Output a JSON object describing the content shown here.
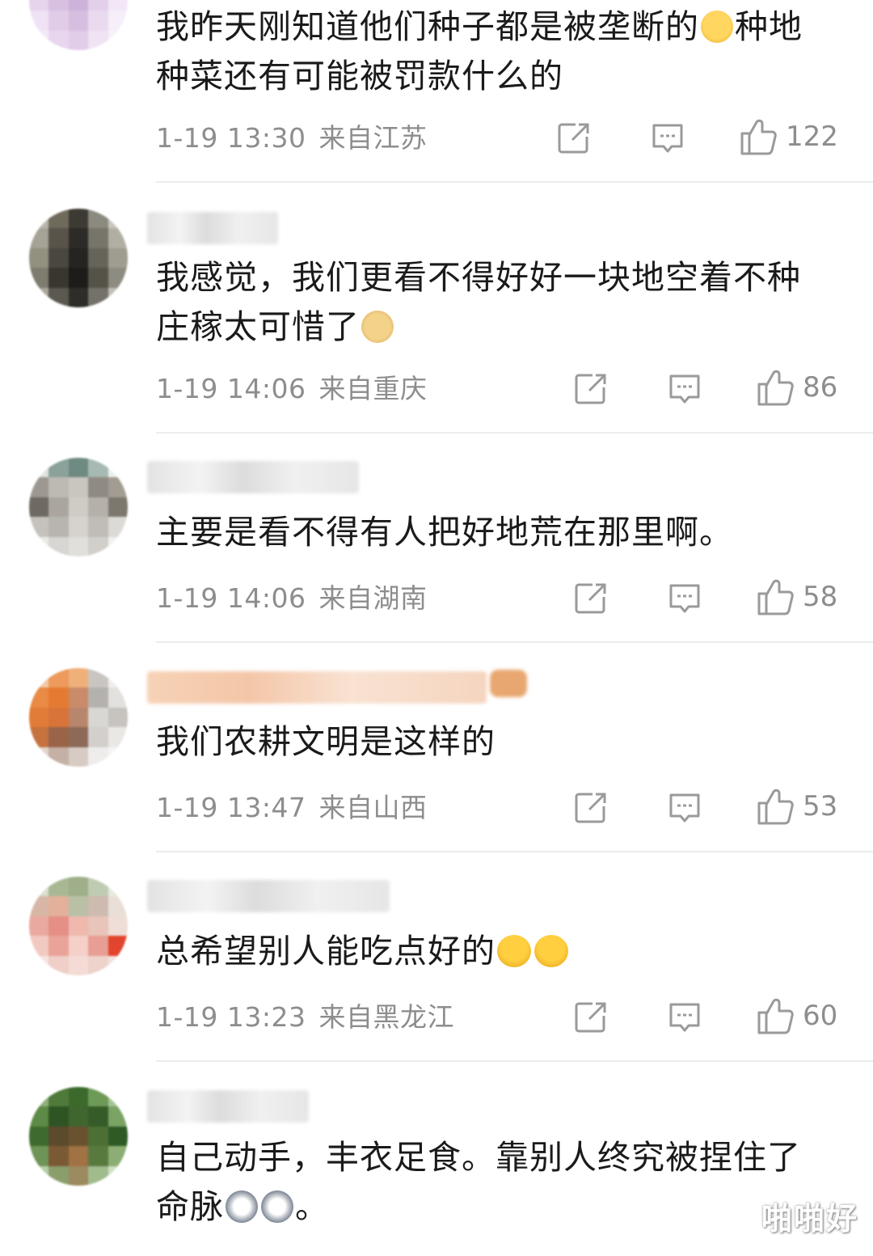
{
  "comments": [
    {
      "text": "我昨天刚知道他们种子都是被垄断的",
      "text_after_emoji": "种地种菜还有可能被罚款什么的",
      "emoji": "laugh-cry-emoji",
      "time": "1-19 13:30",
      "location": "来自江苏",
      "likes": "122"
    },
    {
      "text": "我感觉，我们更看不得好好一块地空着不种庄稼太可惜了",
      "emoji": "doge-emoji",
      "time": "1-19 14:06",
      "location": "来自重庆",
      "likes": "86"
    },
    {
      "text": "主要是看不得有人把好地荒在那里啊。",
      "time": "1-19 14:06",
      "location": "来自湖南",
      "likes": "58"
    },
    {
      "text": "我们农耕文明是这样的",
      "time": "1-19 13:47",
      "location": "来自山西",
      "likes": "53"
    },
    {
      "text": "总希望别人能吃点好的",
      "emoji": "shrug-emoji",
      "time": "1-19 13:23",
      "location": "来自黑龙江",
      "likes": "60"
    },
    {
      "text": "自己动手，丰衣足食。靠别人终究被捏住了命脉",
      "text_end": "。",
      "emoji": "husky-emoji"
    }
  ],
  "watermark": "啪啪好",
  "colors": {
    "text": "#1a1a1a",
    "meta": "#8d8d8d",
    "divider": "#ececec",
    "icon": "#9a9a9a"
  }
}
